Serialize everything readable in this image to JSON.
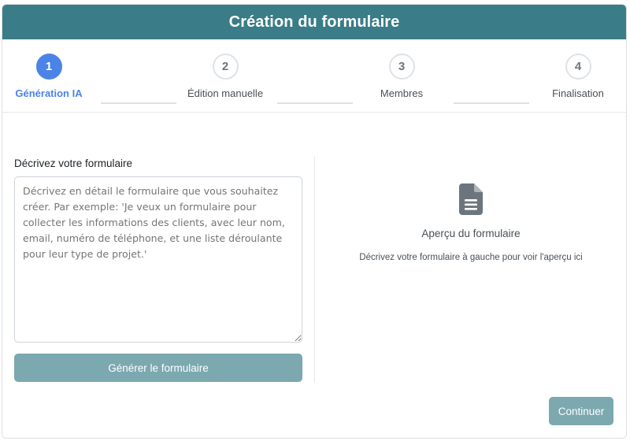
{
  "header": {
    "title": "Création du formulaire"
  },
  "steps": [
    {
      "number": "1",
      "label": "Génération IA",
      "active": true
    },
    {
      "number": "2",
      "label": "Édition manuelle",
      "active": false
    },
    {
      "number": "3",
      "label": "Membres",
      "active": false
    },
    {
      "number": "4",
      "label": "Finalisation",
      "active": false
    }
  ],
  "form": {
    "label": "Décrivez votre formulaire",
    "placeholder": "Décrivez en détail le formulaire que vous souhaitez créer. Par exemple: 'Je veux un formulaire pour collecter les informations des clients, avec leur nom, email, numéro de téléphone, et une liste déroulante pour leur type de projet.'",
    "value": "",
    "generate_label": "Générer le formulaire"
  },
  "preview": {
    "icon": "file-document-icon",
    "title": "Aperçu du formulaire",
    "hint": "Décrivez votre formulaire à gauche pour voir l'aperçu ici"
  },
  "footer": {
    "continue_label": "Continuer"
  },
  "colors": {
    "header_bg": "#3a7c87",
    "active_step": "#4b84e6",
    "button_bg": "#7ca8b0",
    "icon": "#6c757d"
  }
}
